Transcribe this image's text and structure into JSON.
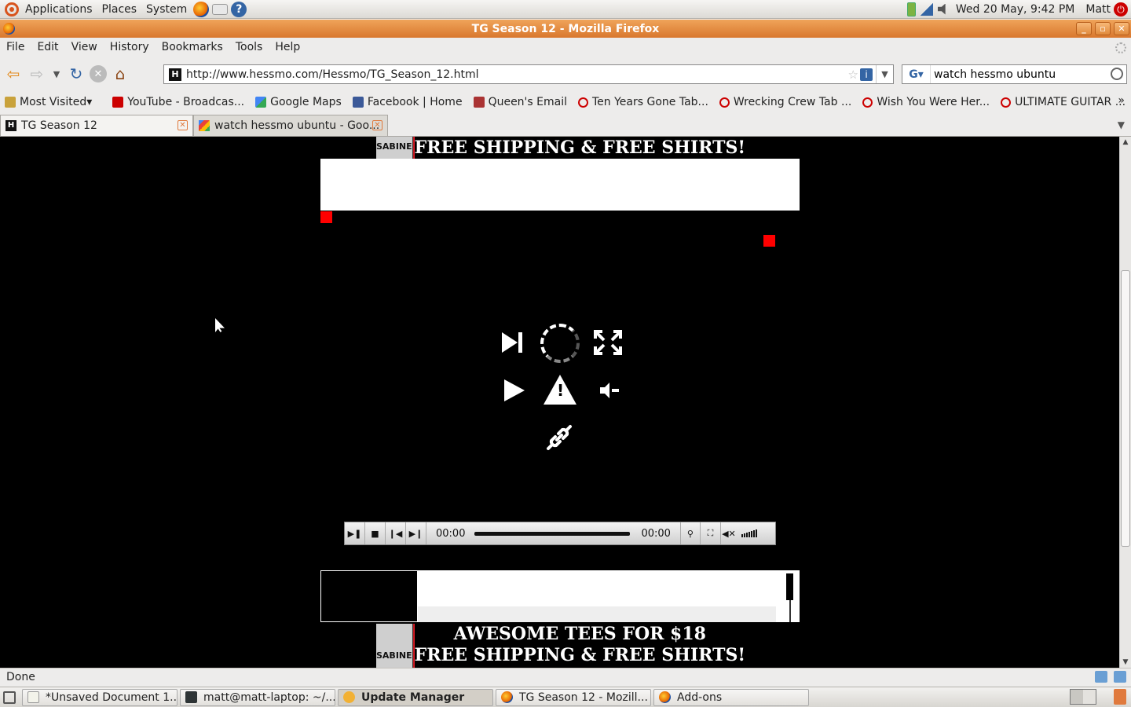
{
  "top_panel": {
    "menus": [
      "Applications",
      "Places",
      "System"
    ],
    "clock": "Wed 20 May,  9:42 PM",
    "user": "Matt"
  },
  "window": {
    "title": "TG Season 12 - Mozilla Firefox"
  },
  "menubar": {
    "items": [
      "File",
      "Edit",
      "View",
      "History",
      "Bookmarks",
      "Tools",
      "Help"
    ]
  },
  "navbar": {
    "url": "http://www.hessmo.com/Hessmo/TG_Season_12.html",
    "site_icon_letter": "H",
    "search_value": "watch hessmo ubuntu",
    "search_engine": "G"
  },
  "bookmarks": {
    "most_visited": "Most Visited",
    "items": [
      "YouTube - Broadcas...",
      "Google Maps",
      "Facebook | Home",
      "Queen's Email",
      "Ten Years Gone Tab...",
      "Wrecking Crew Tab ...",
      "Wish You Were Her...",
      "ULTIMATE GUITAR ..."
    ],
    "overflow": "»"
  },
  "tabs": [
    {
      "label": "TG Season 12",
      "active": true
    },
    {
      "label": "watch hessmo ubuntu - Goo...",
      "active": false
    }
  ],
  "content": {
    "banner_top_line1": "FREE SHIPPING & FREE SHIRTS!",
    "banner_bottom_line1": "AWESOME TEES FOR $18",
    "banner_bottom_line2": "FREE SHIPPING & FREE SHIRTS!",
    "banner_shirt_label": "SABINE",
    "player": {
      "time_elapsed": "00:00",
      "time_total": "00:00"
    }
  },
  "statusbar": {
    "text": "Done"
  },
  "taskbar": [
    {
      "label": "*Unsaved Document 1...",
      "icon": "gedit-icon"
    },
    {
      "label": "matt@matt-laptop: ~/...",
      "icon": "terminal-icon"
    },
    {
      "label": "Update Manager",
      "icon": "update-icon",
      "active": true
    },
    {
      "label": "TG Season 12 - Mozill...",
      "icon": "firefox-icon"
    },
    {
      "label": "Add-ons",
      "icon": "firefox-icon"
    }
  ],
  "colors": {
    "titlebar": "#e08a3d",
    "content_bg": "#000000",
    "ad_red": "#ff0000"
  }
}
